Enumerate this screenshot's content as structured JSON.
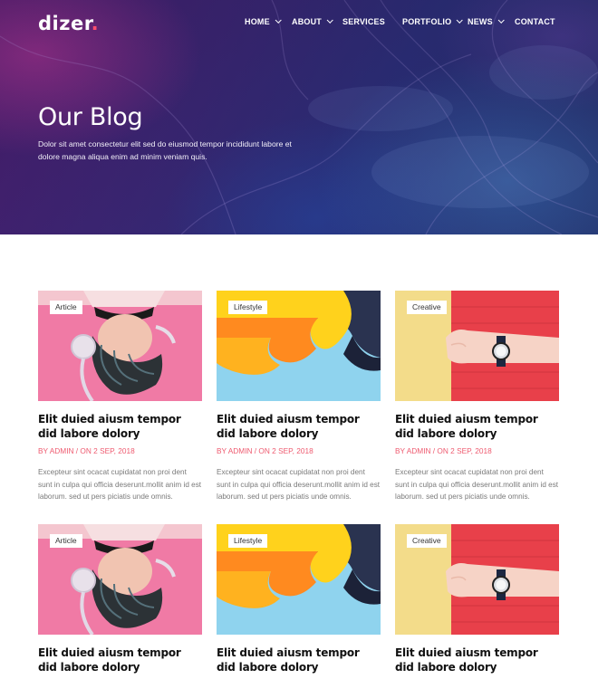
{
  "brand": {
    "name": "dizer",
    "dot": ".",
    "accent": "#ff4f6e"
  },
  "nav": {
    "items": [
      {
        "label": "HOME",
        "dropdown": true
      },
      {
        "label": "ABOUT",
        "dropdown": true
      },
      {
        "label": "SERVICES",
        "dropdown": false
      },
      {
        "label": "PORTFOLIO",
        "dropdown": true
      },
      {
        "label": "NEWS",
        "dropdown": true
      },
      {
        "label": "CONTACT",
        "dropdown": false
      }
    ]
  },
  "hero": {
    "title": "Our Blog",
    "description": "Dolor sit amet consectetur elit sed do eiusmod tempor incididunt labore et dolore magna aliqua enim ad minim veniam quis."
  },
  "posts": [
    {
      "tag": "Article",
      "image": "headphones-woman",
      "title": "Elit duied aiusm tempor did labore dolory",
      "author": "BY ADMIN",
      "date": "ON 2 SEP, 2018",
      "excerpt": "Excepteur sint ocacat cupidatat non proi dent sunt in culpa qui officia deserunt.mollit anim id est laborum. sed ut pers piciatis unde omnis."
    },
    {
      "tag": "Lifestyle",
      "image": "paper-folds",
      "title": "Elit duied aiusm tempor did labore dolory",
      "author": "BY ADMIN",
      "date": "ON 2 SEP, 2018",
      "excerpt": "Excepteur sint ocacat cupidatat non proi dent sunt in culpa qui officia deserunt.mollit anim id est laborum. sed ut pers piciatis unde omnis."
    },
    {
      "tag": "Creative",
      "image": "wrist-watch",
      "title": "Elit duied aiusm tempor did labore dolory",
      "author": "BY ADMIN",
      "date": "ON 2 SEP, 2018",
      "excerpt": "Excepteur sint ocacat cupidatat non proi dent sunt in culpa qui officia deserunt.mollit anim id est laborum. sed ut pers piciatis unde omnis."
    },
    {
      "tag": "Article",
      "image": "headphones-woman",
      "title": "Elit duied aiusm tempor did labore dolory",
      "author": "",
      "date": "",
      "excerpt": ""
    },
    {
      "tag": "Lifestyle",
      "image": "paper-folds",
      "title": "Elit duied aiusm tempor did labore dolory",
      "author": "",
      "date": "",
      "excerpt": ""
    },
    {
      "tag": "Creative",
      "image": "wrist-watch",
      "title": "Elit duied aiusm tempor did labore dolory",
      "author": "",
      "date": "",
      "excerpt": ""
    }
  ],
  "meta_separator": " / ",
  "colors": {
    "meta": "#ee5a6f",
    "title": "#111111",
    "excerpt": "#7a7a7a"
  }
}
